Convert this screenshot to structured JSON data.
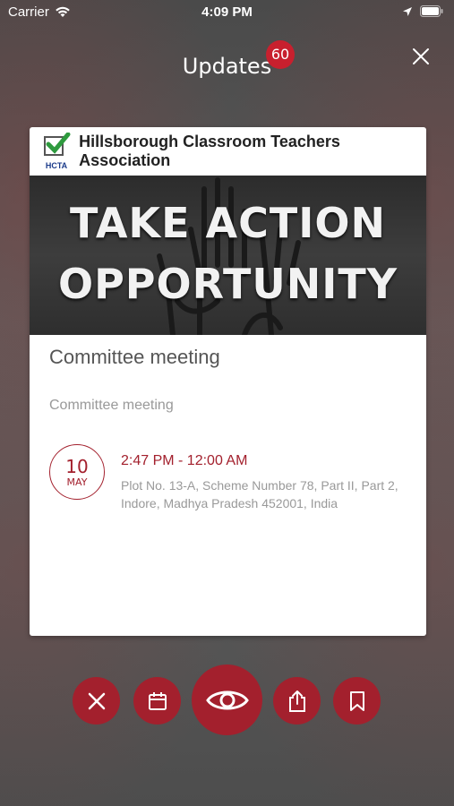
{
  "status_bar": {
    "carrier": "Carrier",
    "time": "4:09 PM",
    "icons": [
      "wifi-icon",
      "location-arrow-icon",
      "battery-icon"
    ]
  },
  "header": {
    "title": "Updates",
    "badge_count": "60"
  },
  "card": {
    "org_name": "Hillsborough Classroom Teachers Association",
    "org_logo_text": "HCTA",
    "banner_line1": "TAKE ACTION",
    "banner_line2": "OPPORTUNITY",
    "event_title": "Committee meeting",
    "event_description": "Committee meeting",
    "date_day": "10",
    "date_month": "MAY",
    "event_time": "2:47 PM - 12:00 AM",
    "event_address": "Plot No. 13-A, Scheme Number 78, Part II, Part 2, Indore, Madhya Pradesh 452001, India"
  },
  "actions": [
    "close-icon",
    "calendar-icon",
    "eye-icon",
    "share-icon",
    "bookmark-icon"
  ],
  "colors": {
    "accent": "#a3202d",
    "badge": "#c8202e"
  }
}
